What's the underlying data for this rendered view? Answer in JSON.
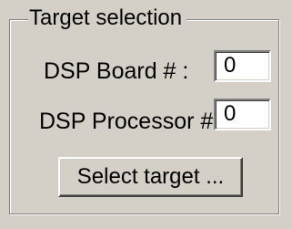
{
  "group": {
    "title": "Target selection"
  },
  "dsp_board": {
    "label": "DSP Board # :",
    "value": "0"
  },
  "dsp_processor": {
    "label": "DSP Processor # :",
    "value": "0"
  },
  "select_target_button": {
    "label": "Select target ..."
  }
}
